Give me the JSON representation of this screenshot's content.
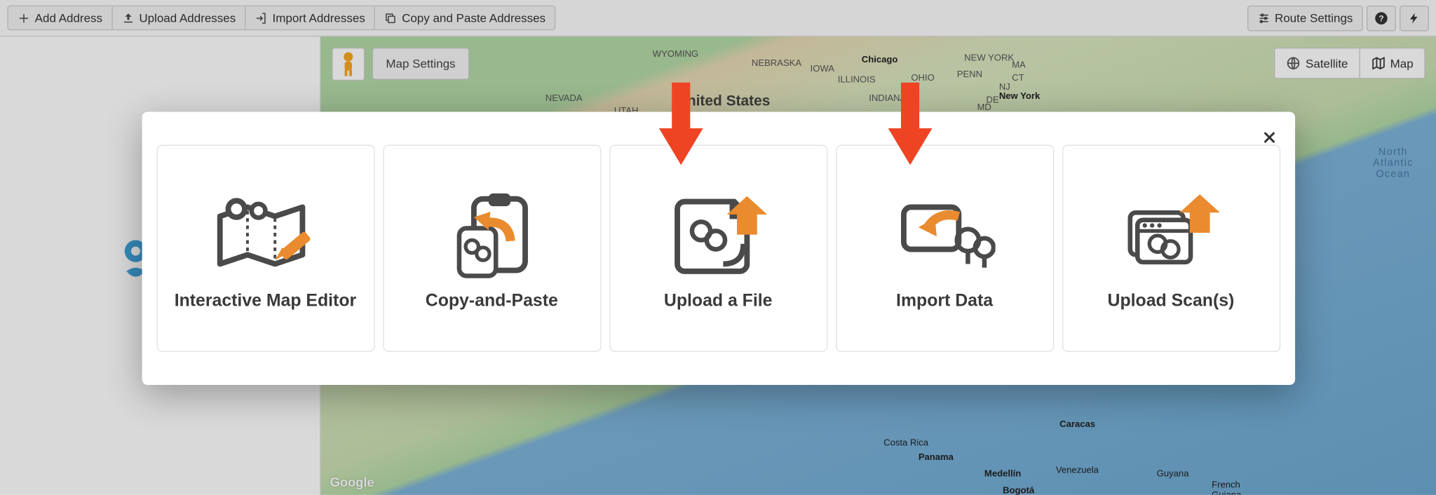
{
  "toolbar": {
    "add_address": "Add Address",
    "upload_addresses": "Upload Addresses",
    "import_addresses": "Import Addresses",
    "copy_paste_addresses": "Copy and Paste Addresses",
    "route_settings": "Route Settings"
  },
  "map": {
    "settings_btn": "Map Settings",
    "satellite": "Satellite",
    "map": "Map",
    "google": "Google",
    "ocean": "North\nAtlantic\nOcean",
    "labels": {
      "nevada": "NEVADA",
      "utah": "UTAH",
      "wyoming": "WYOMING",
      "nebraska": "NEBRASKA",
      "iowa": "IOWA",
      "us": "United States",
      "chicago": "Chicago",
      "illinois": "ILLINOIS",
      "indiana": "INDIANA",
      "ohio": "OHIO",
      "penn": "PENN",
      "ny": "NEW YORK",
      "newyork": "New York",
      "ma": "MA",
      "ct": "CT",
      "nj": "NJ",
      "de": "DE",
      "md": "MD",
      "costa": "Costa Rica",
      "panama": "Panama",
      "caracas": "Caracas",
      "venezuela": "Venezuela",
      "medellin": "Medellín",
      "bogota": "Bogotá",
      "guyana": "Guyana",
      "french": "French\nGuiana"
    }
  },
  "modal": {
    "cards": {
      "interactive_map": "Interactive Map Editor",
      "copy_paste": "Copy-and-Paste",
      "upload_file": "Upload a File",
      "import_data": "Import Data",
      "upload_scans": "Upload Scan(s)"
    }
  }
}
